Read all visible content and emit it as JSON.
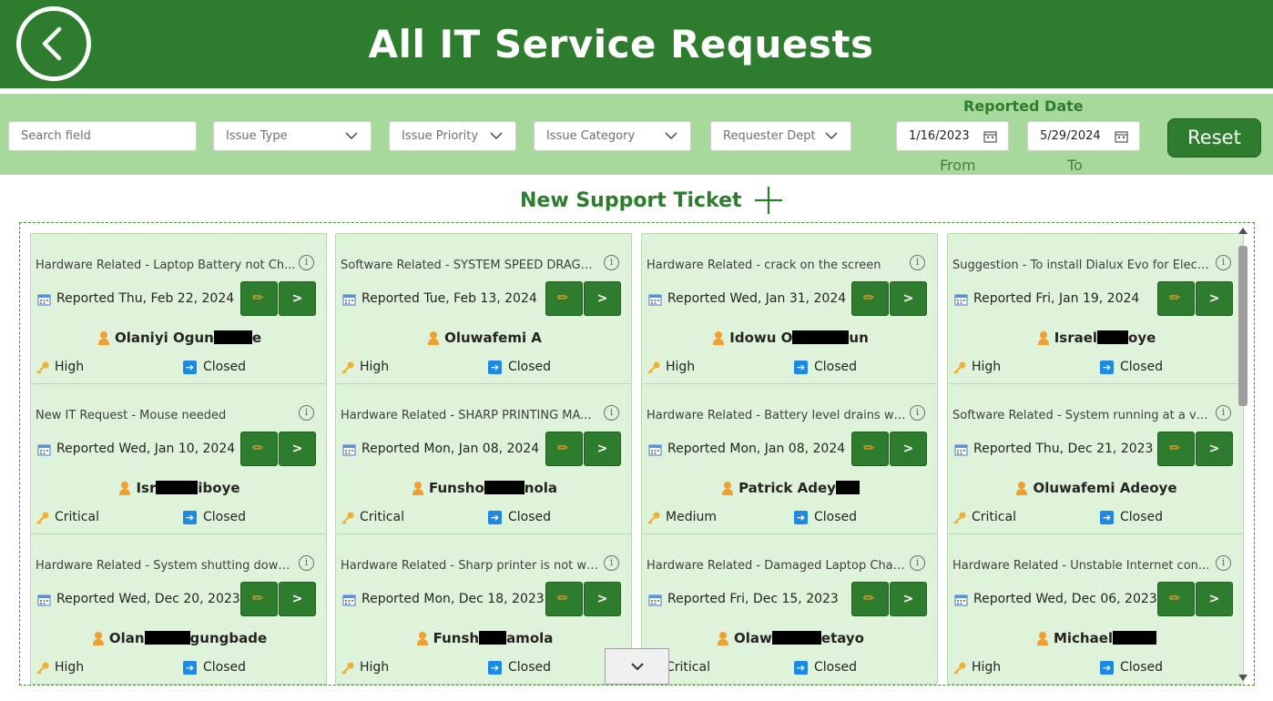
{
  "header": {
    "title": "All IT Service Requests"
  },
  "filters": {
    "search_placeholder": "Search field",
    "issue_type": "Issue Type",
    "issue_priority": "Issue Priority",
    "issue_category": "Issue Category",
    "requester_dept": "Requester Dept",
    "date_title": "Reported Date",
    "from_date": "1/16/2023",
    "to_date": "5/29/2024",
    "from_label": "From",
    "to_label": "To",
    "reset_label": "Reset"
  },
  "new_ticket": {
    "label": "New Support Ticket"
  },
  "card_buttons": {
    "go_label": ">"
  },
  "tickets": [
    {
      "title": "Hardware Related - Laptop Battery not Ch...",
      "reported": "Reported Thu, Feb 22, 2024",
      "name_a": "Olaniyi Ogun",
      "name_b": "e",
      "priority": "High",
      "status": "Closed"
    },
    {
      "title": "Software Related - SYSTEM SPEED DRAGG...",
      "reported": "Reported Tue, Feb 13, 2024",
      "name_a": "Oluwafemi A",
      "name_b": "",
      "priority": "High",
      "status": "Closed"
    },
    {
      "title": "Hardware Related - crack on the screen",
      "reported": "Reported Wed, Jan 31, 2024",
      "name_a": "Idowu O",
      "name_b": "un",
      "priority": "High",
      "status": "Closed"
    },
    {
      "title": "Suggestion - To install Dialux Evo for Electr...",
      "reported": "Reported Fri, Jan 19, 2024",
      "name_a": "Israel",
      "name_b": "oye",
      "priority": "High",
      "status": "Closed"
    },
    {
      "title": "New IT Request - Mouse needed",
      "reported": "Reported Wed, Jan 10, 2024",
      "name_a": "Isr",
      "name_b": "iboye",
      "priority": "Critical",
      "status": "Closed"
    },
    {
      "title": "Hardware Related - SHARP PRINTING MA...",
      "reported": "Reported Mon, Jan 08, 2024",
      "name_a": "Funsho",
      "name_b": "nola",
      "priority": "Critical",
      "status": "Closed"
    },
    {
      "title": "Hardware Related - Battery level drains wh...",
      "reported": "Reported Mon, Jan 08, 2024",
      "name_a": "Patrick Adey",
      "name_b": "",
      "priority": "Medium",
      "status": "Closed"
    },
    {
      "title": "Software Related - System running at a ver...",
      "reported": "Reported Thu, Dec 21, 2023",
      "name_a": "Oluwafemi Adeoye",
      "name_b": "",
      "priority": "Critical",
      "status": "Closed"
    },
    {
      "title": "Hardware Related - System shutting down ...",
      "reported": "Reported Wed, Dec 20, 2023",
      "name_a": "Olan",
      "name_b": "gungbade",
      "priority": "High",
      "status": "Closed"
    },
    {
      "title": "Hardware Related - Sharp printer is not wo...",
      "reported": "Reported Mon, Dec 18, 2023",
      "name_a": "Funsh",
      "name_b": "amola",
      "priority": "High",
      "status": "Closed"
    },
    {
      "title": "Hardware Related - Damaged Laptop Char...",
      "reported": "Reported Fri, Dec 15, 2023",
      "name_a": "Olaw",
      "name_b": "etayo",
      "priority": "Critical",
      "status": "Closed"
    },
    {
      "title": "Hardware Related - Unstable Internet con...",
      "reported": "Reported Wed, Dec 06, 2023",
      "name_a": "Michael",
      "name_b": "",
      "priority": "High",
      "status": "Closed"
    }
  ]
}
